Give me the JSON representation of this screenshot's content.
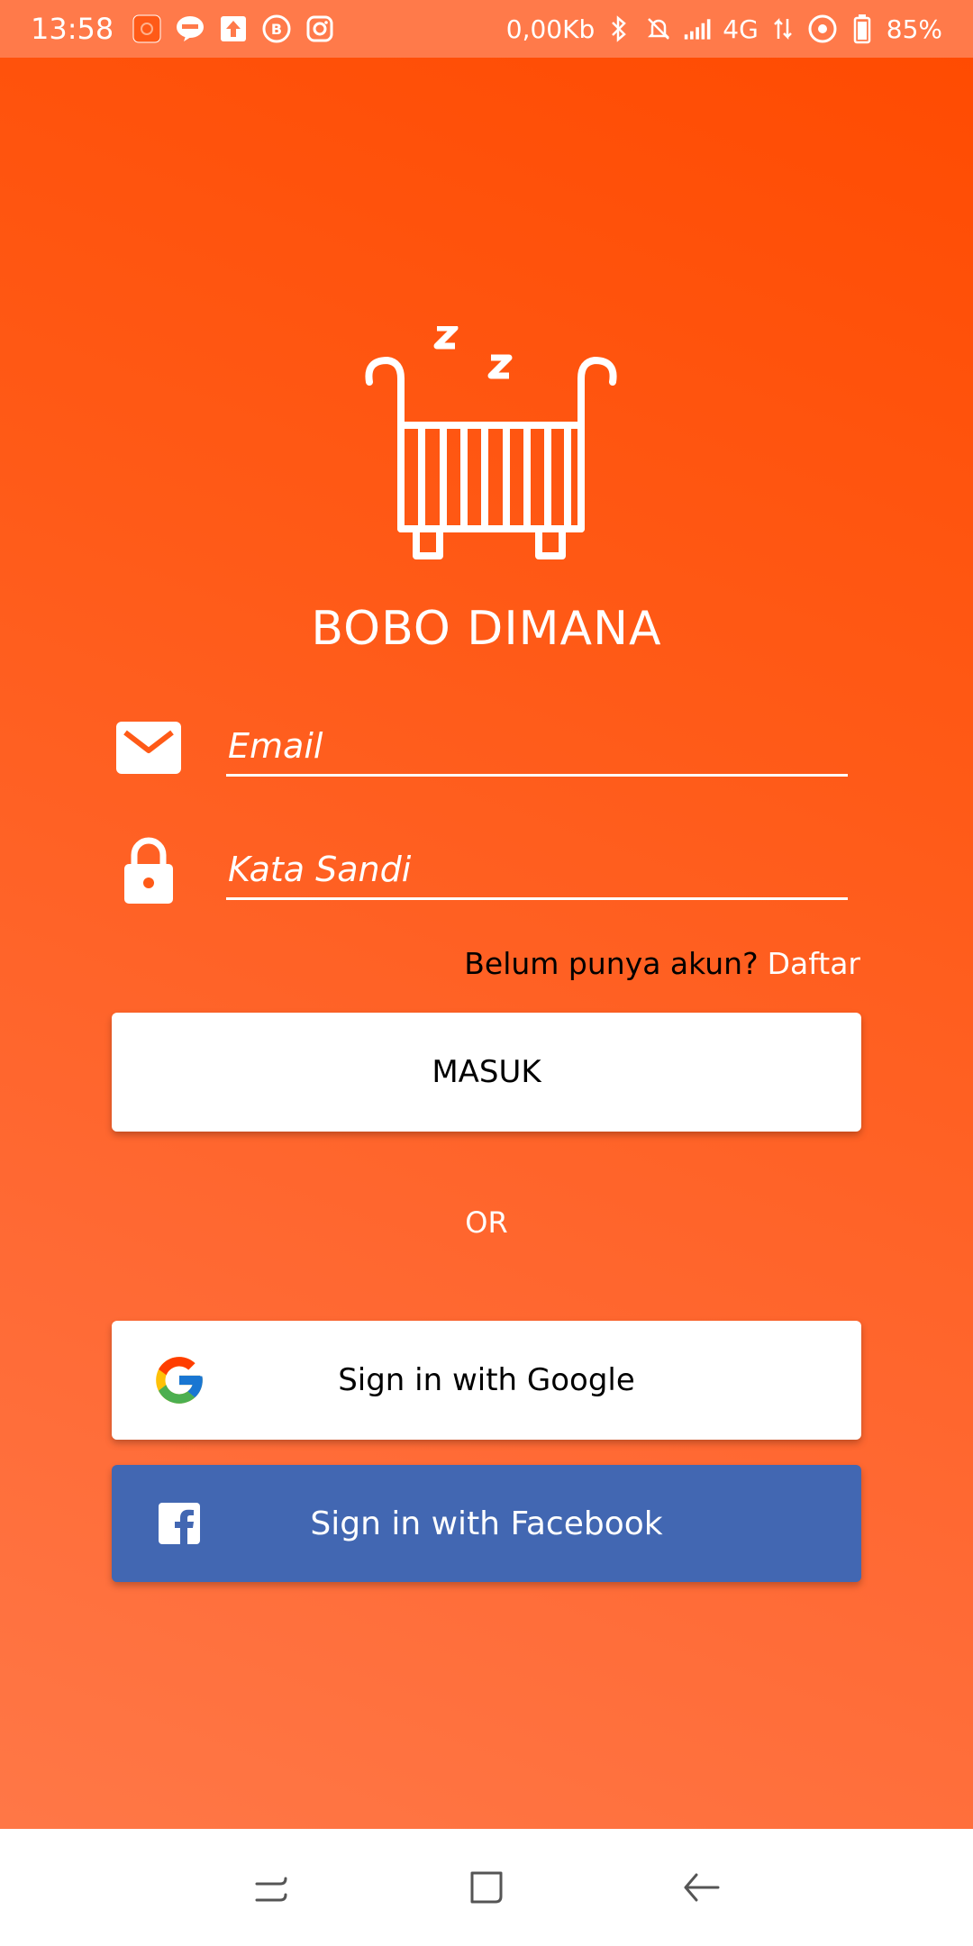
{
  "status_bar": {
    "time": "13:58",
    "network_speed": "0,00Kb",
    "network_type": "4G",
    "battery": "85%",
    "icons": [
      "app-notification-icon",
      "line-icon",
      "upload-icon",
      "b-icon",
      "instagram-icon",
      "bluetooth-icon",
      "mute-icon",
      "signal-icon",
      "data-arrows-icon",
      "sync-icon",
      "battery-icon"
    ]
  },
  "app": {
    "title": "BOBO DIMANA",
    "logo_icon": "crib-sleep-icon"
  },
  "form": {
    "email_placeholder": "Email",
    "password_placeholder": "Kata Sandi",
    "register_prompt": "Belum punya akun?",
    "register_link": "Daftar",
    "login_label": "MASUK",
    "or_label": "OR",
    "google_label": "Sign in with Google",
    "facebook_label": "Sign in with Facebook"
  },
  "nav": {
    "icons": [
      "recent-apps-icon",
      "home-icon",
      "back-icon"
    ]
  },
  "colors": {
    "background": "#ff5a17",
    "facebook": "#4267b2",
    "status_bar": "#ff7a4a"
  }
}
